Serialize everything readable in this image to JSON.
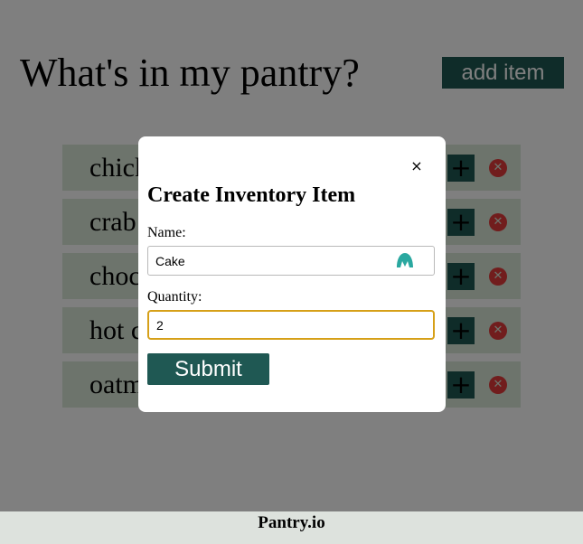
{
  "header": {
    "title": "What's in my pantry?",
    "add_label": "add item"
  },
  "items": [
    {
      "name": "chicken",
      "plus": "+",
      "delete": "✕"
    },
    {
      "name": "crab",
      "plus": "+",
      "delete": "✕"
    },
    {
      "name": "chocolate",
      "plus": "+",
      "delete": "✕"
    },
    {
      "name": "hot cocoa",
      "plus": "+",
      "delete": "✕"
    },
    {
      "name": "oatmeal",
      "plus": "+",
      "delete": "✕"
    }
  ],
  "footer": {
    "text": "Pantry.io"
  },
  "modal": {
    "close": "×",
    "title": "Create Inventory Item",
    "name_label": "Name:",
    "name_value": "Cake",
    "quantity_label": "Quantity:",
    "quantity_value": "2",
    "submit_label": "Submit"
  },
  "colors": {
    "primary": "#1f5853",
    "item_bg": "#dbe9d9",
    "delete": "#e23a3a",
    "focus_ring": "#d6a018",
    "autofill_icon": "#2aa8a0"
  },
  "icons": {
    "plus": "plus-icon",
    "delete": "delete-circle-icon",
    "close": "close-icon",
    "autofill": "password-manager-icon"
  }
}
